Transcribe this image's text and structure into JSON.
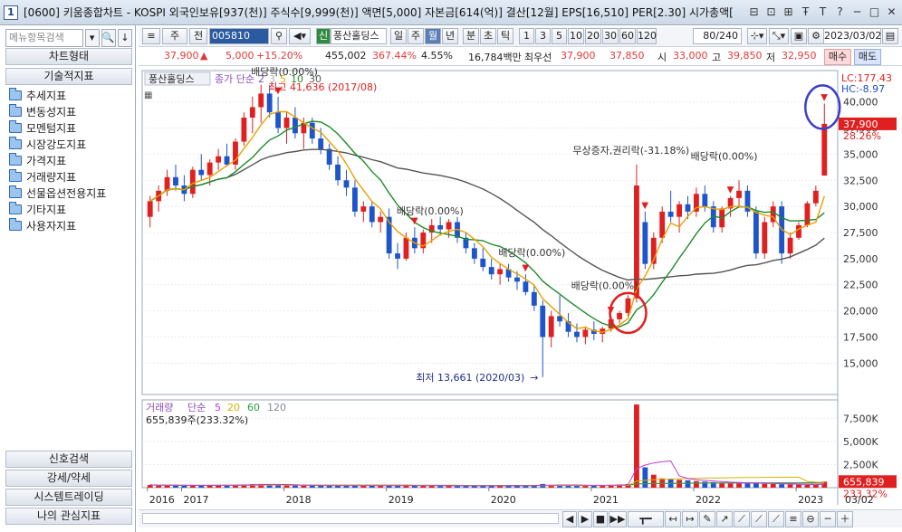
{
  "window": {
    "number": "1",
    "title": "[0600] 키움종합차트 - KOSPI 외국인보유[937(천)] 주식수[9,999(천)] 액면[5,000] 자본금[614(억)] 결산[12월] EPS[16,510] PER[2.30] 시가총액[",
    "controls": [
      "⊟",
      "⊡",
      "⊞",
      "Ŧ",
      "T",
      "?",
      "─",
      "□",
      "✕"
    ]
  },
  "left_panel": {
    "search_placeholder": "메뉴항목검색",
    "search_buttons": [
      "▾",
      "🔍",
      "↓"
    ],
    "header_top": "차트형태",
    "header_tech": "기술적지표",
    "tree": [
      "추세지표",
      "변동성지표",
      "모멘텀지표",
      "시장강도지표",
      "가격지표",
      "거래량지표",
      "선물옵션전용지표",
      "기타지표",
      "사용자지표"
    ],
    "bottom_buttons": [
      "신호검색",
      "강세/약세",
      "시스템트레이딩",
      "나의 관심지표"
    ]
  },
  "toolbar1": {
    "stock_type": "주",
    "prev": "전",
    "code": "005810",
    "name_tag": "신",
    "name": "풍산홀딩스",
    "periods": [
      "일",
      "주",
      "월",
      "년",
      "분",
      "초",
      "틱"
    ],
    "active_period": "월",
    "intervals": [
      "1",
      "3",
      "5",
      "10",
      "20",
      "30",
      "60",
      "120"
    ],
    "count": "80/240",
    "date": "2023/03/02"
  },
  "toolbar2": {
    "price": "37,900",
    "price_arrow": "▲",
    "change": "5,000",
    "change_pct": "+15.20%",
    "volume": "455,002",
    "volume_pct": "367.44%",
    "turnover_pct": "4.55%",
    "amount": "16,784백만",
    "best_label": "최우선",
    "best_ask": "37,900",
    "best_bid": "37,850",
    "open_label": "시",
    "open": "33,000",
    "high_label": "고",
    "high": "39,850",
    "low_label": "저",
    "low": "32,950",
    "buy": "매수",
    "sell": "매도"
  },
  "chart_data": [
    {
      "type": "candlestick",
      "title": "풍산홀딩스",
      "legend": [
        "종가 단순",
        "2",
        "3",
        "5",
        "10",
        "30"
      ],
      "series_colors": {
        "up": "#e02020",
        "down": "#1f55c9",
        "ma5": "#e8a000",
        "ma10": "#1e8a2a",
        "ma30": "#555555"
      },
      "y_ticks": [
        15000,
        17500,
        20000,
        22500,
        25000,
        27500,
        30000,
        32500,
        35000,
        37500,
        40000
      ],
      "y_tick_labels": [
        "15,000",
        "17,500",
        "20,000",
        "22,500",
        "25,000",
        "27,500",
        "30,000",
        "32,500",
        "35,000",
        "37,500",
        "40,000"
      ],
      "ylim": [
        12000,
        43000
      ],
      "x_labels": [
        "2016",
        "2017",
        "2018",
        "2019",
        "2020",
        "2021",
        "2022",
        "2023",
        "03/02"
      ],
      "lc_label": "LC:177.43",
      "hc_label": "HC:-8.97",
      "last_price_label": "37,900",
      "last_pct_label": "28.26%",
      "annotations": [
        {
          "text": "최고 41,636 (2017/08)",
          "color": "#e02020"
        },
        {
          "text": "배당락(0.00%)",
          "color": "#333"
        },
        {
          "text": "배당락(0.00%)",
          "color": "#333"
        },
        {
          "text": "배당락(0.00%)",
          "color": "#333"
        },
        {
          "text": "배당락(0.00%)",
          "color": "#333"
        },
        {
          "text": "무상증자,권리락(-31.18%)",
          "color": "#333"
        },
        {
          "text": "배당락(0.00%)",
          "color": "#333"
        },
        {
          "text": "배당락(0.00%)",
          "color": "#333"
        },
        {
          "text": "최저 13,661 (2020/03)",
          "color": "#1f2d8a"
        }
      ],
      "ohlc": [
        [
          29000,
          31000,
          28000,
          30500
        ],
        [
          30500,
          32000,
          29500,
          31500
        ],
        [
          31500,
          33500,
          31000,
          32800
        ],
        [
          32800,
          34000,
          31500,
          32000
        ],
        [
          32000,
          33000,
          30500,
          31200
        ],
        [
          31200,
          33800,
          30800,
          33500
        ],
        [
          33500,
          35000,
          32500,
          33000
        ],
        [
          33000,
          34500,
          32000,
          34200
        ],
        [
          34200,
          35500,
          33500,
          34800
        ],
        [
          34800,
          36000,
          33800,
          34000
        ],
        [
          34000,
          36500,
          33500,
          36200
        ],
        [
          36200,
          39000,
          35800,
          38500
        ],
        [
          38500,
          40500,
          37000,
          39500
        ],
        [
          39500,
          41636,
          38000,
          40800
        ],
        [
          40800,
          41600,
          38500,
          39000
        ],
        [
          39000,
          40500,
          37000,
          37500
        ],
        [
          37500,
          39000,
          36000,
          38500
        ],
        [
          38500,
          39500,
          36500,
          37000
        ],
        [
          37000,
          38500,
          35500,
          38000
        ],
        [
          38000,
          38500,
          36000,
          36500
        ],
        [
          36500,
          37500,
          35000,
          35500
        ],
        [
          35500,
          36000,
          33500,
          34000
        ],
        [
          34000,
          34800,
          32000,
          32500
        ],
        [
          32500,
          33500,
          31000,
          31800
        ],
        [
          31800,
          32500,
          29000,
          29500
        ],
        [
          29500,
          30500,
          28500,
          30000
        ],
        [
          30000,
          30500,
          28000,
          28500
        ],
        [
          28500,
          29500,
          27500,
          29000
        ],
        [
          29000,
          29800,
          25000,
          25500
        ],
        [
          25500,
          26500,
          24000,
          25000
        ],
        [
          25000,
          27500,
          24800,
          27000
        ],
        [
          27000,
          28000,
          25500,
          26000
        ],
        [
          26000,
          27800,
          25500,
          27500
        ],
        [
          27500,
          28800,
          26500,
          28200
        ],
        [
          28200,
          29000,
          27200,
          27800
        ],
        [
          27800,
          28800,
          27000,
          28500
        ],
        [
          28500,
          29000,
          26500,
          27000
        ],
        [
          27000,
          27500,
          25500,
          26000
        ],
        [
          26000,
          26500,
          24500,
          25000
        ],
        [
          25000,
          26000,
          23800,
          24200
        ],
        [
          24200,
          25000,
          23000,
          23500
        ],
        [
          23500,
          24500,
          22500,
          24000
        ],
        [
          24000,
          24500,
          22800,
          23200
        ],
        [
          23200,
          23800,
          22000,
          22800
        ],
        [
          22800,
          23500,
          21500,
          21800
        ],
        [
          21800,
          22500,
          20000,
          20500
        ],
        [
          20500,
          21000,
          13661,
          17500
        ],
        [
          17500,
          20000,
          16500,
          19500
        ],
        [
          19500,
          21500,
          18500,
          19000
        ],
        [
          19000,
          19800,
          17500,
          18000
        ],
        [
          18000,
          18800,
          17000,
          17500
        ],
        [
          17500,
          18500,
          16800,
          18200
        ],
        [
          18200,
          19000,
          17200,
          17800
        ],
        [
          17800,
          18500,
          17000,
          18300
        ],
        [
          18300,
          19500,
          18000,
          19200
        ],
        [
          19200,
          20000,
          18800,
          19800
        ],
        [
          19800,
          21500,
          19500,
          21200
        ],
        [
          21200,
          34000,
          20800,
          32000
        ],
        [
          28500,
          29500,
          24000,
          24500
        ],
        [
          24500,
          27500,
          24000,
          27000
        ],
        [
          27000,
          30000,
          26500,
          29500
        ],
        [
          29500,
          31500,
          28500,
          29000
        ],
        [
          29000,
          30500,
          27500,
          30200
        ],
        [
          30200,
          31000,
          28800,
          29500
        ],
        [
          29500,
          31800,
          29000,
          31200
        ],
        [
          31200,
          32000,
          29500,
          30000
        ],
        [
          30000,
          30500,
          27500,
          28000
        ],
        [
          28000,
          30000,
          27500,
          29800
        ],
        [
          29800,
          31000,
          29000,
          30800
        ],
        [
          30800,
          32500,
          30000,
          31500
        ],
        [
          31500,
          32000,
          29000,
          29500
        ],
        [
          29500,
          30000,
          25000,
          25500
        ],
        [
          25500,
          29000,
          25000,
          28500
        ],
        [
          28500,
          30500,
          28000,
          30000
        ],
        [
          30000,
          30500,
          24500,
          25500
        ],
        [
          25500,
          27500,
          25000,
          27000
        ],
        [
          27000,
          28500,
          26800,
          28200
        ],
        [
          28200,
          30500,
          28000,
          30300
        ],
        [
          30300,
          32000,
          30000,
          31500
        ],
        [
          32950,
          39850,
          32950,
          37900
        ]
      ]
    },
    {
      "type": "bar",
      "title": "거래량",
      "legend": [
        "거래량",
        "단순",
        "5",
        "20",
        "60",
        "120"
      ],
      "value_label": "655,839주(233.32%)",
      "y_ticks": [
        2500,
        5000,
        7500
      ],
      "y_tick_labels": [
        "2,500K",
        "5,000K",
        "7,500K"
      ],
      "ylim": [
        0,
        9500
      ],
      "last_value_label": "655,839",
      "last_pct_label": "233.32%",
      "values": [
        300,
        250,
        260,
        240,
        230,
        250,
        260,
        240,
        300,
        260,
        280,
        350,
        380,
        400,
        330,
        300,
        280,
        250,
        230,
        220,
        210,
        220,
        230,
        210,
        230,
        220,
        210,
        200,
        250,
        230,
        240,
        220,
        200,
        210,
        190,
        200,
        190,
        200,
        210,
        200,
        190,
        200,
        210,
        200,
        220,
        250,
        400,
        300,
        280,
        250,
        240,
        230,
        260,
        280,
        300,
        350,
        400,
        9000,
        2200,
        1400,
        1000,
        900,
        850,
        800,
        700,
        650,
        600,
        550,
        500,
        500,
        480,
        450,
        420,
        400,
        380,
        350,
        330,
        300,
        320,
        655
      ]
    }
  ],
  "bottom_toolbar": [
    "◀",
    "▶",
    "■",
    "▶▶",
    "┳━",
    "↤",
    "↦",
    "✎",
    "↗",
    "⟋",
    "⟋",
    "⟋",
    "≡",
    "⊖",
    "─",
    "＋"
  ]
}
